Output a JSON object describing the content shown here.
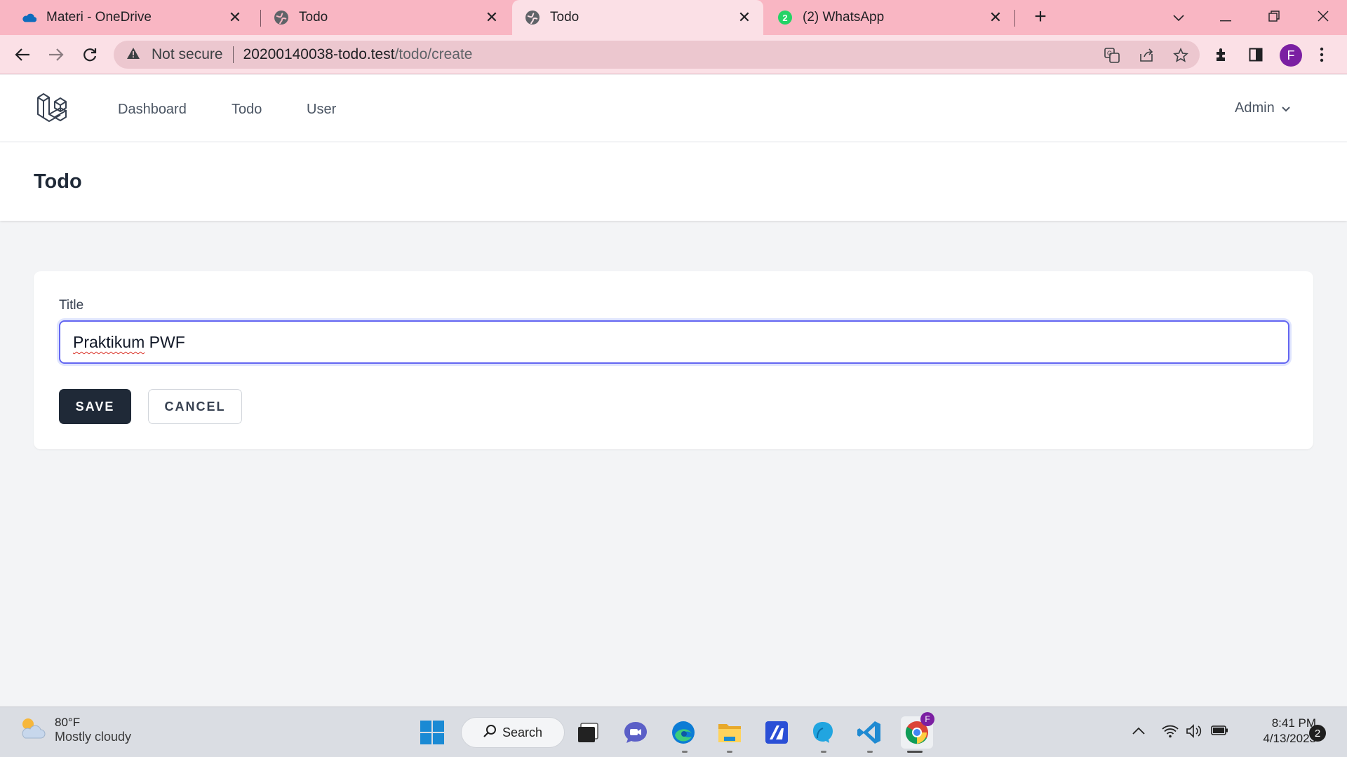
{
  "browser": {
    "tabs": [
      {
        "title": "Materi - OneDrive",
        "icon": "onedrive-icon",
        "active": false
      },
      {
        "title": "Todo",
        "icon": "globe-icon",
        "active": false
      },
      {
        "title": "Todo",
        "icon": "globe-icon",
        "active": true
      },
      {
        "title": "(2) WhatsApp",
        "icon": "whatsapp-icon",
        "active": false
      }
    ],
    "tab_close_glyph": "✕",
    "new_tab_glyph": "+",
    "omnibox": {
      "security_label": "Not secure",
      "host": "20200140038-todo.test",
      "path": "/todo/create"
    },
    "profile_initial": "F",
    "whatsapp_badge": "2"
  },
  "app": {
    "nav": {
      "links": [
        "Dashboard",
        "Todo",
        "User"
      ],
      "user_menu": "Admin"
    },
    "header": {
      "title": "Todo"
    },
    "form": {
      "title_label": "Title",
      "title_value_word1": "Praktikum",
      "title_value_word2": " PWF",
      "save_label": "SAVE",
      "cancel_label": "CANCEL",
      "input_focus_color": "#6366f1"
    }
  },
  "taskbar": {
    "weather": {
      "temp": "80°F",
      "condition": "Mostly cloudy"
    },
    "search_label": "Search",
    "clock": {
      "time": "8:41 PM",
      "date": "4/13/2023"
    },
    "notifications": "2",
    "chrome_badge": "F"
  },
  "colors": {
    "tab_strip": "#f9b6c3",
    "toolbar": "#fbe0e6",
    "page_bg": "#f3f4f6",
    "save_button": "#1f2937"
  }
}
